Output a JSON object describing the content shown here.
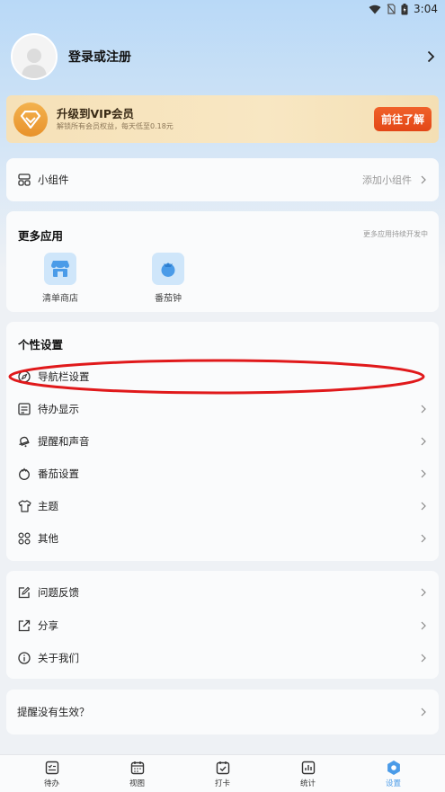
{
  "status_bar": {
    "time": "3:04"
  },
  "profile": {
    "title": "登录或注册"
  },
  "vip": {
    "title": "升级到VIP会员",
    "subtitle": "解锁所有会员权益，每天低至0.18元",
    "button": "前往了解"
  },
  "widget_card": {
    "label": "小组件",
    "right": "添加小组件"
  },
  "more_apps": {
    "title": "更多应用",
    "hint": "更多应用持续开发中",
    "apps": [
      {
        "label": "清单商店",
        "icon": "store-icon"
      },
      {
        "label": "番茄钟",
        "icon": "tomato-icon"
      }
    ]
  },
  "personal": {
    "title": "个性设置",
    "items": [
      {
        "label": "导航栏设置",
        "icon": "compass-icon"
      },
      {
        "label": "待办显示",
        "icon": "list-icon"
      },
      {
        "label": "提醒和声音",
        "icon": "bell-icon"
      },
      {
        "label": "番茄设置",
        "icon": "tomato-outline-icon"
      },
      {
        "label": "主题",
        "icon": "shirt-icon"
      },
      {
        "label": "其他",
        "icon": "grid-icon"
      }
    ]
  },
  "misc": {
    "items": [
      {
        "label": "问题反馈",
        "icon": "feedback-icon"
      },
      {
        "label": "分享",
        "icon": "share-icon"
      },
      {
        "label": "关于我们",
        "icon": "info-icon"
      }
    ]
  },
  "reminder_help": {
    "label": "提醒没有生效？"
  },
  "tabs": [
    {
      "label": "待办",
      "icon": "todo-icon"
    },
    {
      "label": "视图",
      "icon": "calendar-icon"
    },
    {
      "label": "打卡",
      "icon": "checkin-icon"
    },
    {
      "label": "统计",
      "icon": "stats-icon"
    },
    {
      "label": "设置",
      "icon": "settings-icon",
      "active": true
    }
  ],
  "colors": {
    "accent": "#4a9be8",
    "vip_button": "#e9501f",
    "annotation": "#e0191b"
  }
}
